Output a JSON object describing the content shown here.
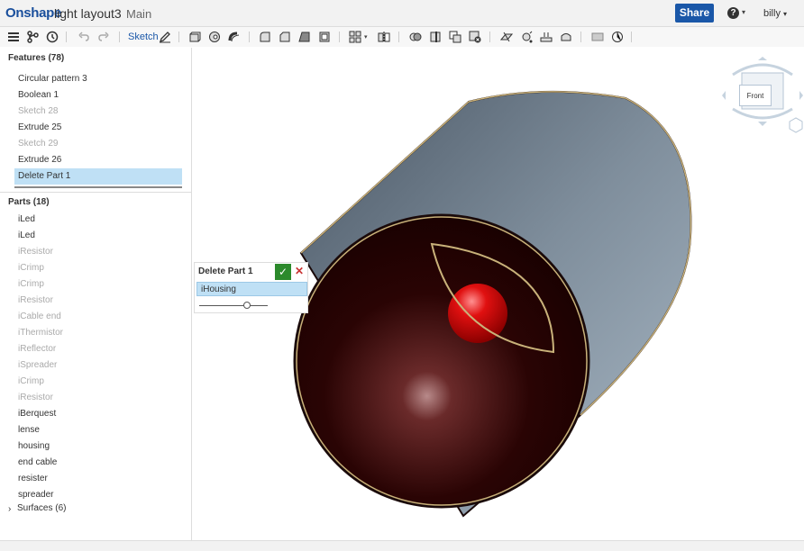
{
  "app": {
    "logo": "Onshape",
    "document_name": "light layout3",
    "workspace": "Main",
    "share_label": "Share",
    "help_label": "?",
    "user_name": "billy"
  },
  "toolbar": {
    "sketch_label": "Sketch",
    "icons": [
      "menu-icon",
      "branch-icon",
      "history-icon",
      "undo-icon",
      "redo-icon",
      "sketch-pen-icon",
      "extrude-icon",
      "revolve-icon",
      "sweep-icon",
      "fillet-icon",
      "chamfer-icon",
      "draft-icon",
      "shell-icon",
      "pattern-icon",
      "mirror-icon",
      "boolean-icon",
      "split-icon",
      "transform-icon",
      "delete-part-icon",
      "plane-icon",
      "helix-icon",
      "thicken-icon",
      "enclose-icon",
      "view-icon",
      "section-icon"
    ]
  },
  "features": {
    "header": "Features (78)",
    "items": [
      {
        "label": "Circular pattern 3",
        "dim": false
      },
      {
        "label": "Boolean 1",
        "dim": false
      },
      {
        "label": "Sketch 28",
        "dim": true
      },
      {
        "label": "Extrude 25",
        "dim": false
      },
      {
        "label": "Sketch 29",
        "dim": true
      },
      {
        "label": "Extrude 26",
        "dim": false
      },
      {
        "label": "Delete Part 1",
        "dim": false,
        "selected": true
      }
    ]
  },
  "parts": {
    "header": "Parts (18)",
    "items": [
      {
        "label": "iLed",
        "dim": false
      },
      {
        "label": "iLed",
        "dim": false
      },
      {
        "label": "iResistor",
        "dim": true
      },
      {
        "label": "iCrimp",
        "dim": true
      },
      {
        "label": "iCrimp",
        "dim": true
      },
      {
        "label": "iResistor",
        "dim": true
      },
      {
        "label": "iCable end",
        "dim": true
      },
      {
        "label": "iThermistor",
        "dim": true
      },
      {
        "label": "iReflector",
        "dim": true
      },
      {
        "label": "iSpreader",
        "dim": true
      },
      {
        "label": "iCrimp",
        "dim": true
      },
      {
        "label": "iResistor",
        "dim": true
      },
      {
        "label": "iBerquest",
        "dim": false
      },
      {
        "label": "lense",
        "dim": false
      },
      {
        "label": "housing",
        "dim": false
      },
      {
        "label": "end cable",
        "dim": false
      },
      {
        "label": "resister",
        "dim": false
      },
      {
        "label": "spreader",
        "dim": false
      }
    ]
  },
  "surfaces": {
    "header": "Surfaces (6)"
  },
  "dialog": {
    "title": "Delete Part 1",
    "selection": "iHousing",
    "slider_value": 0.7
  },
  "view_cube": {
    "face_label": "Front"
  },
  "colors": {
    "brand": "#1a4f9c",
    "share": "#1a57a8",
    "selection": "#bfe0f5",
    "ok": "#2c8a2c",
    "cancel": "#c83232",
    "housing": "#8a9aa8",
    "cap": "#3a0a0a",
    "led": "#e01010",
    "edge_highlight": "#c9b27a"
  }
}
